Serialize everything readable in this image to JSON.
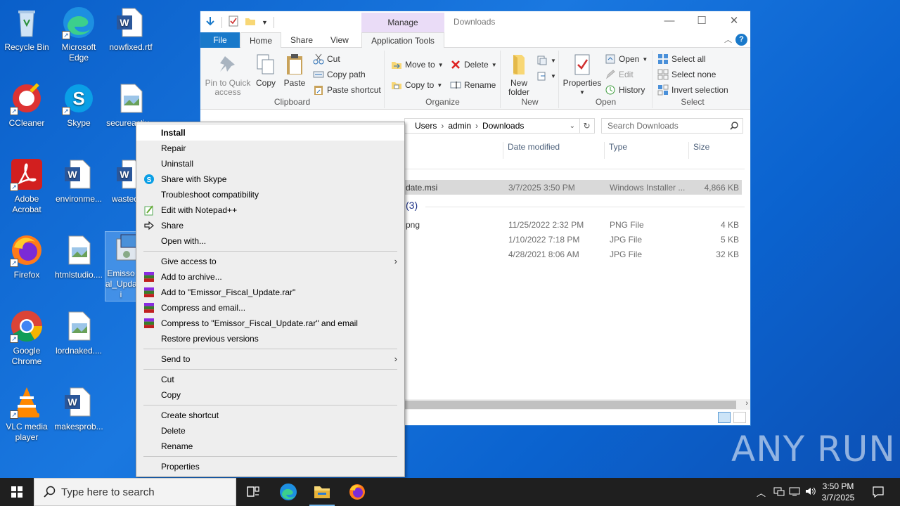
{
  "desktop": {
    "icons": [
      {
        "label": "Recycle Bin"
      },
      {
        "label": "Microsoft Edge"
      },
      {
        "label": "nowfixed.rtf"
      },
      {
        "label": "CCleaner"
      },
      {
        "label": "Skype"
      },
      {
        "label": "secureactiv..."
      },
      {
        "label": "Adobe Acrobat"
      },
      {
        "label": "environme..."
      },
      {
        "label": "wastedc..."
      },
      {
        "label": "Firefox"
      },
      {
        "label": "htmlstudio...."
      },
      {
        "label": "Emissor_Fiscal_Update.msi",
        "display": "Emisso al_Upda i"
      },
      {
        "label": "Google Chrome"
      },
      {
        "label": "lordnaked...."
      },
      {
        "label": "VLC media player"
      },
      {
        "label": "makesprob..."
      }
    ]
  },
  "explorer": {
    "title": "Downloads",
    "manage_tab": "Manage",
    "tabs": {
      "file": "File",
      "home": "Home",
      "share": "Share",
      "view": "View",
      "app_tools": "Application Tools"
    },
    "ribbon": {
      "clipboard": {
        "label": "Clipboard",
        "pin": "Pin to Quick access",
        "copy": "Copy",
        "paste": "Paste",
        "cut": "Cut",
        "copy_path": "Copy path",
        "paste_shortcut": "Paste shortcut"
      },
      "organize": {
        "label": "Organize",
        "move_to": "Move to",
        "copy_to": "Copy to",
        "delete": "Delete",
        "rename": "Rename"
      },
      "new": {
        "label": "New",
        "new_folder": "New folder"
      },
      "open": {
        "label": "Open",
        "properties": "Properties",
        "open": "Open",
        "edit": "Edit",
        "history": "History"
      },
      "select": {
        "label": "Select",
        "select_all": "Select all",
        "select_none": "Select none",
        "invert": "Invert selection"
      }
    },
    "address": {
      "parts": [
        "Users",
        "admin",
        "Downloads"
      ]
    },
    "search_placeholder": "Search Downloads",
    "columns": {
      "date": "Date modified",
      "type": "Type",
      "size": "Size"
    },
    "groups": [
      {
        "count": "(3)"
      }
    ],
    "files": [
      {
        "name": "date.msi",
        "date": "3/7/2025 3:50 PM",
        "type": "Windows Installer ...",
        "size": "4,866 KB"
      },
      {
        "name": "png",
        "date": "11/25/2022 2:32 PM",
        "type": "PNG File",
        "size": "4 KB"
      },
      {
        "name": "",
        "date": "1/10/2022 7:18 PM",
        "type": "JPG File",
        "size": "5 KB"
      },
      {
        "name": "",
        "date": "4/28/2021 8:06 AM",
        "type": "JPG File",
        "size": "32 KB"
      }
    ]
  },
  "context_menu": {
    "install": "Install",
    "repair": "Repair",
    "uninstall": "Uninstall",
    "share_skype": "Share with Skype",
    "troubleshoot": "Troubleshoot compatibility",
    "edit_notepad": "Edit with Notepad++",
    "share": "Share",
    "open_with": "Open with...",
    "give_access": "Give access to",
    "add_archive": "Add to archive...",
    "add_rar": "Add to \"Emissor_Fiscal_Update.rar\"",
    "compress_email": "Compress and email...",
    "compress_rar_email": "Compress to \"Emissor_Fiscal_Update.rar\" and email",
    "restore": "Restore previous versions",
    "send_to": "Send to",
    "cut": "Cut",
    "copy": "Copy",
    "create_shortcut": "Create shortcut",
    "delete": "Delete",
    "rename": "Rename",
    "properties": "Properties"
  },
  "taskbar": {
    "search_placeholder": "Type here to search",
    "time": "3:50 PM",
    "date": "3/7/2025"
  },
  "watermark": "ANY RUN"
}
